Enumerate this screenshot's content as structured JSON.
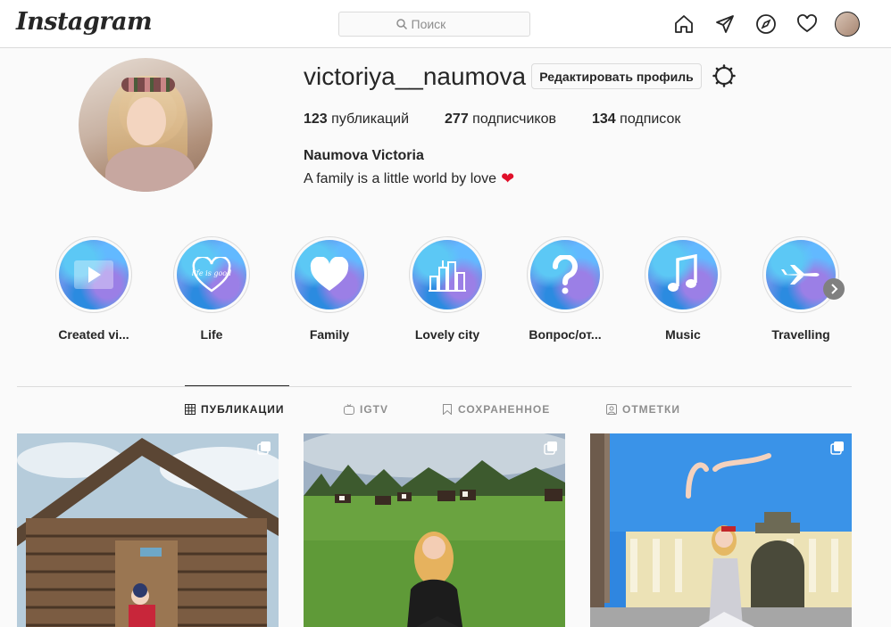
{
  "header": {
    "logo": "Instagram",
    "search_placeholder": "Поиск",
    "icons": [
      "home-icon",
      "direct-icon",
      "explore-icon",
      "activity-icon",
      "profile-avatar"
    ]
  },
  "profile": {
    "username": "victoriya__naumova",
    "edit_button": "Редактировать профиль",
    "stats": [
      {
        "count": "123",
        "label": "публикаций"
      },
      {
        "count": "277",
        "label": "подписчиков"
      },
      {
        "count": "134",
        "label": "подписок"
      }
    ],
    "full_name": "Naumova Victoria",
    "bio": "A family is a little world by love",
    "bio_emoji": "❤"
  },
  "highlights": [
    {
      "label": "Created vi...",
      "icon": "play-icon"
    },
    {
      "label": "Life",
      "icon": "heart-life-icon"
    },
    {
      "label": "Family",
      "icon": "heart-icon"
    },
    {
      "label": "Lovely city",
      "icon": "city-icon"
    },
    {
      "label": "Вопрос/от...",
      "icon": "question-icon"
    },
    {
      "label": "Music",
      "icon": "music-icon"
    },
    {
      "label": "Travelling",
      "icon": "airplane-icon"
    }
  ],
  "tabs": [
    {
      "label": "ПУБЛИКАЦИИ",
      "icon": "grid-icon",
      "active": true
    },
    {
      "label": "IGTV",
      "icon": "igtv-icon",
      "active": false
    },
    {
      "label": "СОХРАНЕННОЕ",
      "icon": "bookmark-icon",
      "active": false
    },
    {
      "label": "ОТМЕТКИ",
      "icon": "tagged-icon",
      "active": false
    }
  ],
  "highlight_overlay_text": "life is good",
  "colors": {
    "accent": "#262626",
    "border": "#dbdbdb",
    "muted": "#8e8e8e",
    "heart": "#e0102a"
  }
}
